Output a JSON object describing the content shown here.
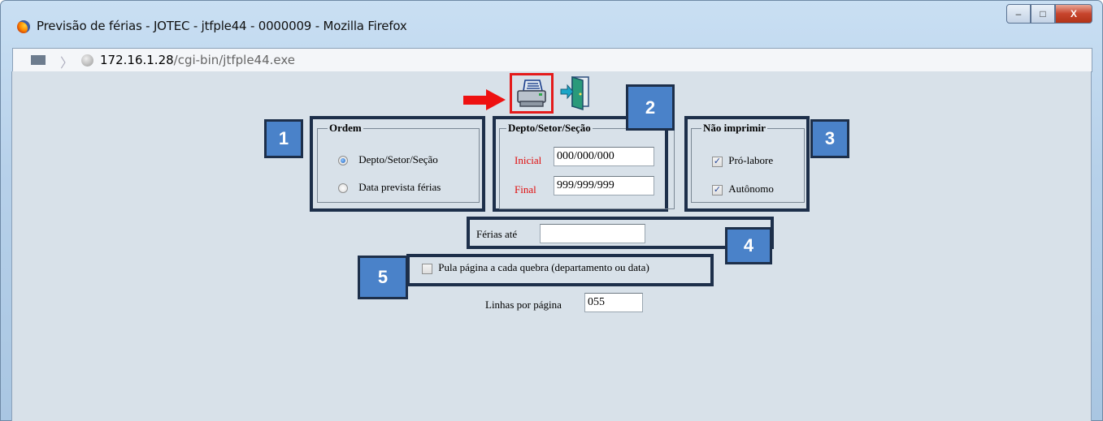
{
  "window": {
    "title": "Previsão de férias - JOTEC - jtfple44 - 0000009 - Mozilla Firefox",
    "controls": {
      "minimize": "–",
      "maximize": "□",
      "close": "X"
    }
  },
  "urlbar": {
    "host": "172.16.1.28",
    "path": "/cgi-bin/jtfple44.exe"
  },
  "ordem": {
    "legend": "Ordem",
    "options": [
      "Depto/Setor/Seção",
      "Data prevista férias"
    ],
    "selected_index": 0
  },
  "depto": {
    "legend": "Depto/Setor/Seção",
    "inicial_label": "Inicial",
    "inicial_value": "000/000/000",
    "final_label": "Final",
    "final_value": "999/999/999"
  },
  "nao_imprimir": {
    "legend": "Não imprimir",
    "items": [
      {
        "label": "Pró-labore",
        "checked": true
      },
      {
        "label": "Autônomo",
        "checked": true
      }
    ]
  },
  "ferias_ate": {
    "label": "Férias até",
    "value": ""
  },
  "pula_pagina": {
    "label": "Pula página a cada quebra (departamento ou data)",
    "checked": false
  },
  "linhas": {
    "label": "Linhas por página",
    "value": "055"
  },
  "annotations": {
    "badges": [
      "1",
      "2",
      "3",
      "4",
      "5"
    ],
    "color": "#4a82c9",
    "highlight_color": "#e41b1b"
  }
}
